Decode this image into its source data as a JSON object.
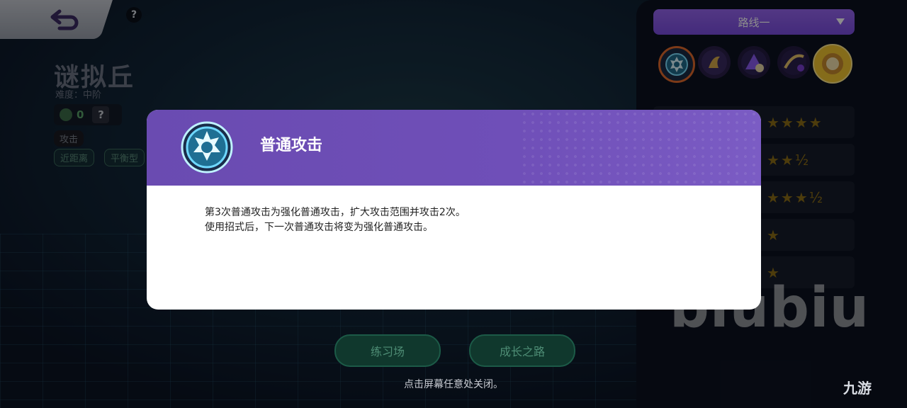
{
  "hero": {
    "name": "谜拟丘",
    "difficulty": "难度：中阶",
    "score": "0",
    "help": "?",
    "role": "攻击",
    "tags": [
      "近距离",
      "平衡型"
    ]
  },
  "right_panel": {
    "route_label": "路线一",
    "skills": [
      {
        "icon": "gear-burst-icon"
      },
      {
        "icon": "shadow-claw-icon"
      },
      {
        "icon": "crystal-icon"
      },
      {
        "icon": "slash-icon"
      },
      {
        "icon": "golden-star-icon"
      }
    ],
    "ratings": [
      {
        "stars": "★★★★"
      },
      {
        "stars": "★★½"
      },
      {
        "stars": "★★★½"
      },
      {
        "stars": "★"
      },
      {
        "stars": "★"
      }
    ]
  },
  "bottom": {
    "practice_button": "练习场",
    "growth_button": "成长之路",
    "close_hint": "点击屏幕任意处关闭。"
  },
  "modal": {
    "title": "普通攻击",
    "description_line1": "第3次普通攻击为强化普通攻击，扩大攻击范围并攻击2次。",
    "description_line2": "使用招式后，下一次普通攻击将变为强化普通攻击。"
  },
  "watermark": "biubiu",
  "site_logo": "九游",
  "colors": {
    "accent_purple": "#7a4de0",
    "modal_header": "#6a4bb1",
    "star_gold": "#8c6d17"
  }
}
